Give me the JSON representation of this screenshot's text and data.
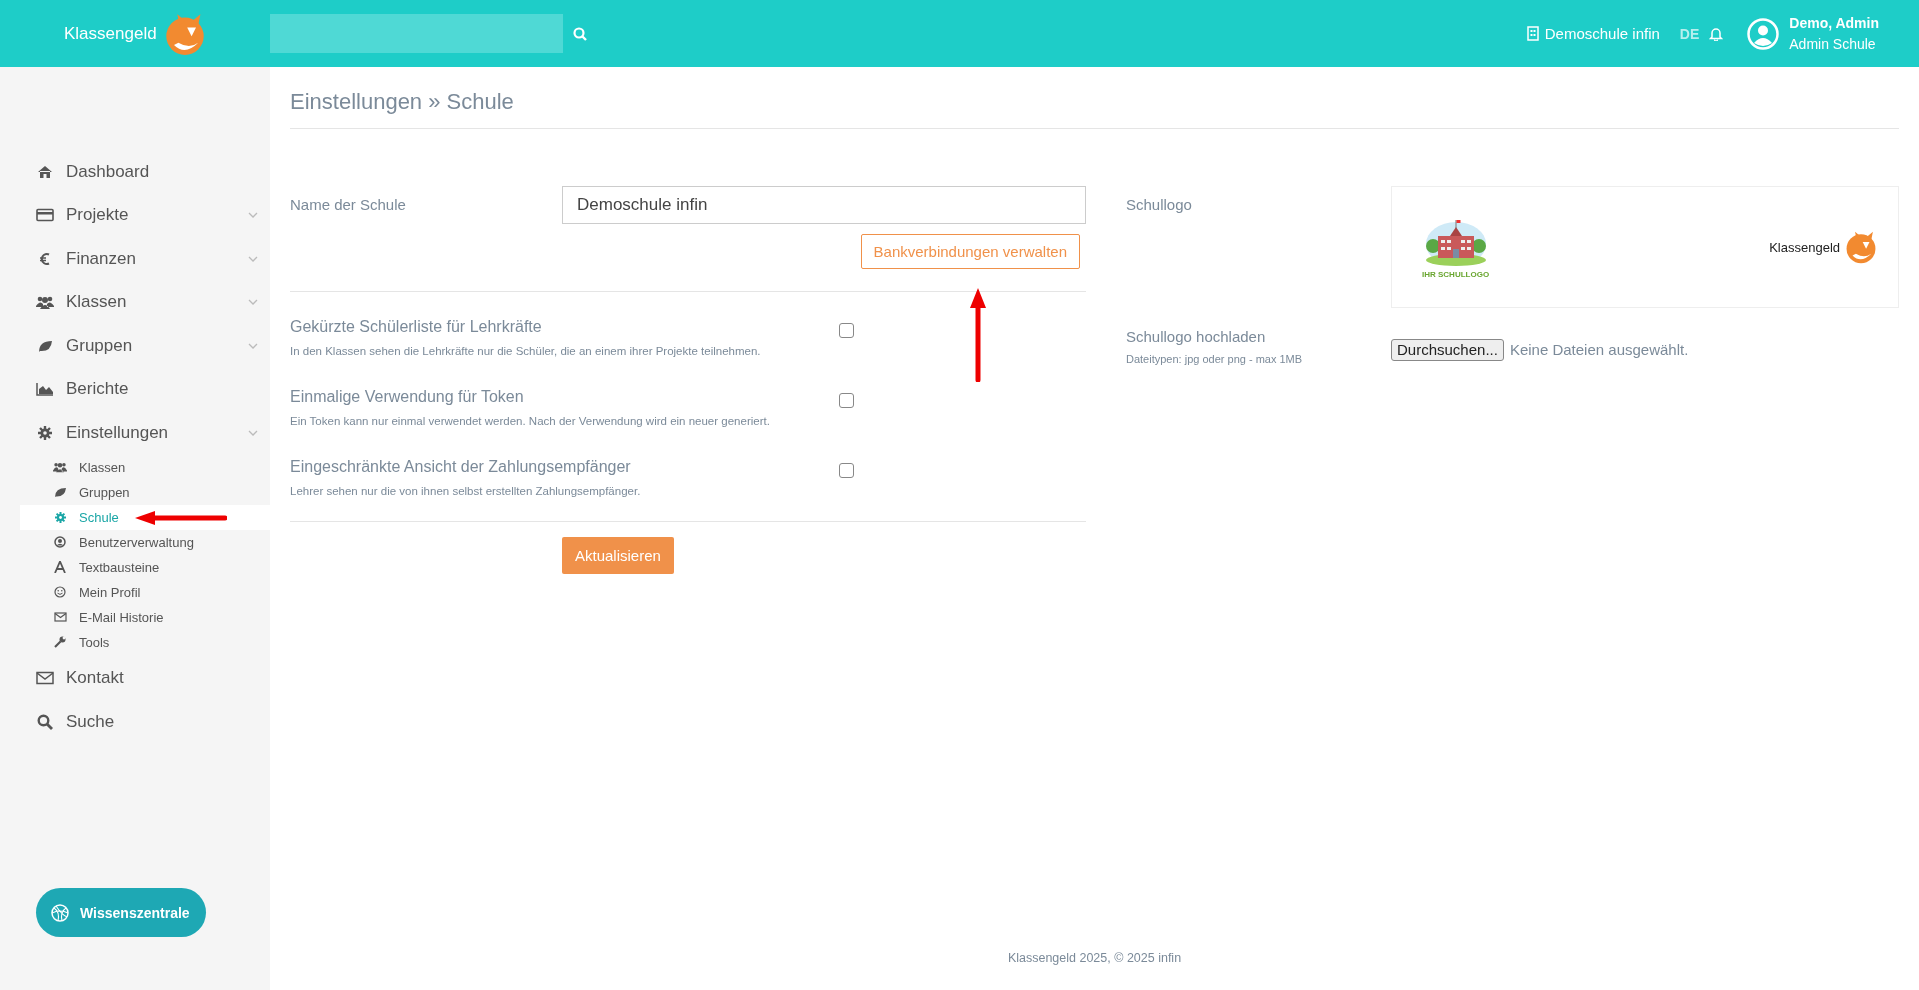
{
  "header": {
    "brand": "Klassengeld",
    "school": "Demoschule infin",
    "language": "DE",
    "user_name": "Demo, Admin",
    "user_role": "Admin Schule"
  },
  "sidebar": {
    "items": [
      {
        "label": "Dashboard",
        "expandable": false
      },
      {
        "label": "Projekte",
        "expandable": true
      },
      {
        "label": "Finanzen",
        "expandable": true
      },
      {
        "label": "Klassen",
        "expandable": true
      },
      {
        "label": "Gruppen",
        "expandable": true
      },
      {
        "label": "Berichte",
        "expandable": false
      },
      {
        "label": "Einstellungen",
        "expandable": true,
        "children": [
          {
            "label": "Klassen",
            "selected": false
          },
          {
            "label": "Gruppen",
            "selected": false
          },
          {
            "label": "Schule",
            "selected": true
          },
          {
            "label": "Benutzerverwaltung",
            "selected": false
          },
          {
            "label": "Textbausteine",
            "selected": false
          },
          {
            "label": "Mein Profil",
            "selected": false
          },
          {
            "label": "E-Mail Historie",
            "selected": false
          },
          {
            "label": "Tools",
            "selected": false
          }
        ]
      },
      {
        "label": "Kontakt",
        "expandable": false
      },
      {
        "label": "Suche",
        "expandable": false
      }
    ],
    "help_button": "Wissenszentrale"
  },
  "page": {
    "title": "Einstellungen » Schule",
    "school_name": {
      "label": "Name der Schule",
      "value": "Demoschule infin"
    },
    "bank_button": "Bankverbindungen verwalten",
    "options": [
      {
        "label": "Gekürzte Schülerliste für Lehrkräfte",
        "description": "In den Klassen sehen die Lehrkräfte nur die Schüler, die an einem ihrer Projekte teilnehmen.",
        "checked": false
      },
      {
        "label": "Einmalige Verwendung für Token",
        "description": "Ein Token kann nur einmal verwendet werden. Nach der Verwendung wird ein neuer generiert.",
        "checked": false
      },
      {
        "label": "Eingeschränkte Ansicht der Zahlungsempfänger",
        "description": "Lehrer sehen nur die von ihnen selbst erstellten Zahlungsempfänger.",
        "checked": false
      }
    ],
    "submit_button": "Aktualisieren",
    "logo": {
      "label": "Schullogo",
      "school_logo_caption": "IHR SCHULLOGO",
      "brand_logo_text": "Klassengeld"
    },
    "upload": {
      "label": "Schullogo hochladen",
      "hint": "Dateitypen: jpg oder png - max 1MB",
      "button": "Durchsuchen...",
      "status": "Keine Dateien ausgewählt."
    }
  },
  "footer": "Klassengeld 2025, © 2025 infin",
  "annotations": [
    {
      "kind": "leftarrow"
    },
    {
      "kind": "uparrow"
    }
  ]
}
